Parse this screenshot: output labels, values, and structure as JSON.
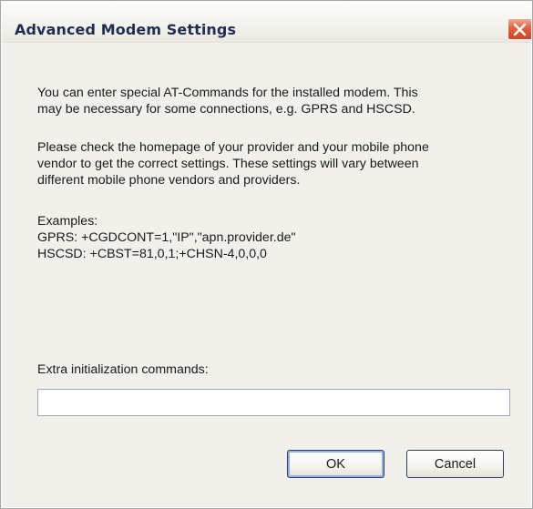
{
  "window": {
    "title": "Advanced Modem Settings",
    "close_icon": "close-icon"
  },
  "body": {
    "paragraph1": [
      "You can enter special AT-Commands for the installed modem. This",
      "may be necessary for some connections, e.g. GPRS and HSCSD."
    ],
    "paragraph2": [
      "Please check the homepage of your provider and your mobile phone",
      "vendor to get the correct settings. These settings will vary between",
      "different mobile phone vendors and providers."
    ],
    "examples": [
      "Examples:",
      "GPRS: +CGDCONT=1,\"IP\",\"apn.provider.de\"",
      "HSCSD: +CBST=81,0,1;+CHSN-4,0,0,0"
    ]
  },
  "extra_init": {
    "label": "Extra initialization commands:",
    "value": "",
    "placeholder": ""
  },
  "buttons": {
    "ok_label": "OK",
    "cancel_label": "Cancel"
  },
  "colors": {
    "title_text": "#1f2e52",
    "close_button": "#e2603f",
    "dialog_background": "#f1f0ea",
    "button_border": "#2c3f66"
  }
}
